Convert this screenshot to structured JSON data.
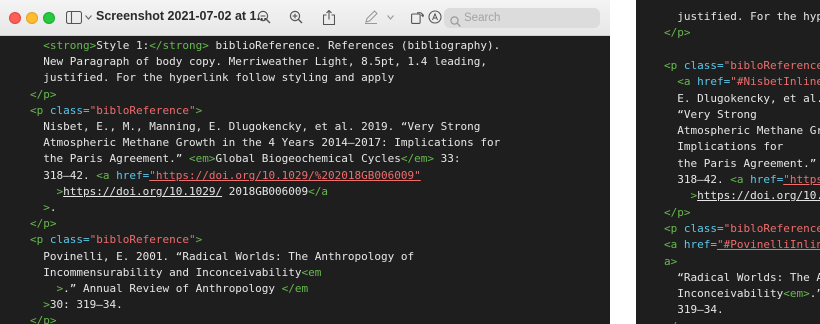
{
  "window": {
    "title": "Screenshot 2021-07-02 at 1...",
    "search_placeholder": "Search"
  },
  "colors": {
    "editor_bg": "#1e1e1e",
    "tag": "#67ba4f",
    "attribute": "#5bc7ea",
    "string": "#ee6d6d",
    "text": "#e6e6e6"
  },
  "toolbar": {
    "icons": [
      "sidebar-toggle-icon",
      "chevron-down-icon",
      "zoom-out-icon",
      "zoom-in-icon",
      "share-icon",
      "markup-pen-icon",
      "chevron-down-icon",
      "rotate-icon",
      "annotate-icon",
      "search-icon"
    ]
  },
  "left_pane": {
    "lines": [
      [
        {
          "c": "tg",
          "t": "  <strong>"
        },
        {
          "c": "tx",
          "t": "Style 1:"
        },
        {
          "c": "tg",
          "t": "</strong>"
        },
        {
          "c": "tx",
          "t": " biblioReference. References (bibliography)."
        }
      ],
      [
        {
          "c": "tx",
          "t": "  New Paragraph of body copy. Merriweather Light, 8.5pt, 1.4 leading,"
        }
      ],
      [
        {
          "c": "tx",
          "t": "  justified. For the hyperlink follow styling and apply"
        }
      ],
      [
        {
          "c": "tg",
          "t": "</p>"
        }
      ],
      [
        {
          "c": "tg",
          "t": "<p "
        },
        {
          "c": "at",
          "t": "class="
        },
        {
          "c": "st",
          "t": "\"bibloReference\""
        },
        {
          "c": "tg",
          "t": ">"
        }
      ],
      [
        {
          "c": "tx",
          "t": "  Nisbet, E., M., Manning, E. Dlugokencky, et al. 2019. “Very Strong"
        }
      ],
      [
        {
          "c": "tx",
          "t": "  Atmospheric Methane Growth in the 4 Years 2014–2017: Implications for"
        }
      ],
      [
        {
          "c": "tx",
          "t": "  the Paris Agreement.” "
        },
        {
          "c": "tg",
          "t": "<em>"
        },
        {
          "c": "tx",
          "t": "Global Biogeochemical Cycles"
        },
        {
          "c": "tg",
          "t": "</em>"
        },
        {
          "c": "tx",
          "t": " 33:"
        }
      ],
      [
        {
          "c": "tx",
          "t": "  318–42. "
        },
        {
          "c": "tg",
          "t": "<a "
        },
        {
          "c": "at",
          "t": "href="
        },
        {
          "c": "st ul",
          "t": "\"https://doi.org/10.1029/%202018GB006009\""
        }
      ],
      [
        {
          "c": "tg",
          "t": "    >"
        },
        {
          "c": "tx ul",
          "t": "https://doi.org/10.1029/"
        },
        {
          "c": "tx",
          "t": " 2018GB006009"
        },
        {
          "c": "tg",
          "t": "</a"
        }
      ],
      [
        {
          "c": "tg",
          "t": "  >"
        },
        {
          "c": "tx",
          "t": "."
        }
      ],
      [
        {
          "c": "tg",
          "t": "</p>"
        }
      ],
      [
        {
          "c": "tg",
          "t": "<p "
        },
        {
          "c": "at",
          "t": "class="
        },
        {
          "c": "st",
          "t": "\"bibloReference\""
        },
        {
          "c": "tg",
          "t": ">"
        }
      ],
      [
        {
          "c": "tx",
          "t": "  Povinelli, E. 2001. “Radical Worlds: The Anthropology of"
        }
      ],
      [
        {
          "c": "tx",
          "t": "  Incommensurability and Inconceivability"
        },
        {
          "c": "tg",
          "t": "<em"
        }
      ],
      [
        {
          "c": "tg",
          "t": "    >"
        },
        {
          "c": "tx",
          "t": ".” Annual Review of Anthropology "
        },
        {
          "c": "tg",
          "t": "</em"
        }
      ],
      [
        {
          "c": "tg",
          "t": "  >"
        },
        {
          "c": "tx",
          "t": "30: 319–34."
        }
      ],
      [
        {
          "c": "tg",
          "t": "</p>"
        }
      ]
    ]
  },
  "right_pane": {
    "lines": [
      [
        {
          "c": "tx",
          "t": "  justified. For the hype"
        }
      ],
      [
        {
          "c": "tg",
          "t": "</p>"
        }
      ],
      [],
      [
        {
          "c": "tg",
          "t": "<p "
        },
        {
          "c": "at",
          "t": "class="
        },
        {
          "c": "st",
          "t": "\"bibloReference\""
        }
      ],
      [
        {
          "c": "tg",
          "t": "  <a "
        },
        {
          "c": "at",
          "t": "href="
        },
        {
          "c": "st",
          "t": "\"#NisbetInline\""
        }
      ],
      [
        {
          "c": "tx",
          "t": "  E. Dlugokencky, et al."
        }
      ],
      [
        {
          "c": "tx",
          "t": "  “Very Strong"
        }
      ],
      [
        {
          "c": "tx",
          "t": "  Atmospheric Methane Gro"
        }
      ],
      [
        {
          "c": "tx",
          "t": "  Implications for"
        }
      ],
      [
        {
          "c": "tx",
          "t": "  the Paris Agreement.” "
        },
        {
          "c": "tg",
          "t": "<"
        }
      ],
      [
        {
          "c": "tx",
          "t": "  318–42. "
        },
        {
          "c": "tg",
          "t": "<a "
        },
        {
          "c": "at",
          "t": "href="
        },
        {
          "c": "st ul",
          "t": "\"https"
        }
      ],
      [
        {
          "c": "tg",
          "t": "    >"
        },
        {
          "c": "tx ul",
          "t": "https://doi.org/10.1"
        }
      ],
      [
        {
          "c": "tg",
          "t": "</p>"
        }
      ],
      [
        {
          "c": "tg",
          "t": "<p "
        },
        {
          "c": "at",
          "t": "class="
        },
        {
          "c": "st",
          "t": "\"bibloReference\""
        }
      ],
      [
        {
          "c": "tg",
          "t": "<a "
        },
        {
          "c": "at",
          "t": "href="
        },
        {
          "c": "st ul",
          "t": "\"#PovinelliInline"
        }
      ],
      [
        {
          "c": "tg",
          "t": "a>"
        }
      ],
      [
        {
          "c": "tx",
          "t": "  “Radical Worlds: The A"
        }
      ],
      [
        {
          "c": "tx",
          "t": "  Inconceivability"
        },
        {
          "c": "tg",
          "t": "<em>"
        },
        {
          "c": "tx",
          "t": ".”"
        }
      ],
      [
        {
          "c": "tx",
          "t": "  319–34."
        }
      ],
      [
        {
          "c": "tg",
          "t": "</p>"
        }
      ]
    ]
  }
}
